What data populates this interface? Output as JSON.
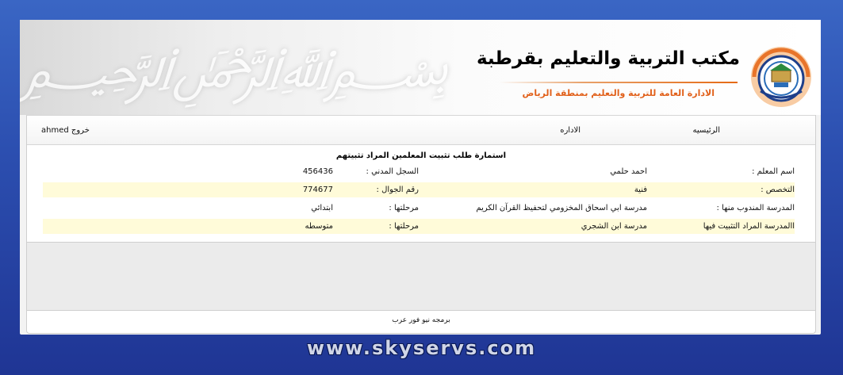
{
  "header": {
    "title": "مكتب التربية والتعليم بقرطبة",
    "subtitle": "الادارة العامة للتربية والتعليم بمنطقة الرياض"
  },
  "nav": {
    "home": "الرئيسيه",
    "admin": "الاداره",
    "logout": "خروج ahmed"
  },
  "form": {
    "title": "استمارة طلب تثبيت المعلمين المراد تثبيتهم",
    "rows": [
      {
        "label1": "اسم المعلم :",
        "value1": "احمد حلمي",
        "label2": "السجل المدني :",
        "value2": "456436"
      },
      {
        "label1": "التخصص :",
        "value1": "فنية",
        "label2": "رقم الجوال :",
        "value2": "774677"
      },
      {
        "label1": "المدرسة المندوب منها :",
        "value1": "مدرسة ابي اسحاق المخزومي لتحفيظ القرآن الكريم",
        "label2": "مرحلتها :",
        "value2": "ابتدائي"
      },
      {
        "label1": "االمدرسة المراد التثبيت فيها",
        "value1": "مدرسة ابن الشجري",
        "label2": "مرحلتها :",
        "value2": "متوسطه"
      }
    ]
  },
  "footer": {
    "text": "برمجه نيو فور عرب"
  },
  "watermark": "www.skyservs.com"
}
